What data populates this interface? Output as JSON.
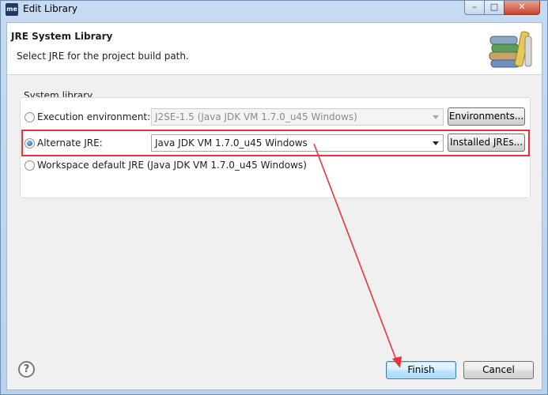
{
  "window": {
    "app_icon_text": "me",
    "title": "Edit Library",
    "minimize_glyph": "–",
    "maximize_glyph": "□",
    "close_glyph": "✕"
  },
  "header": {
    "title": "JRE System Library",
    "description": "Select JRE for the project build path."
  },
  "system_library": {
    "legend": "System library",
    "execution_environment": {
      "label": "Execution environment:",
      "selected": false,
      "value": "J2SE-1.5 (Java JDK VM 1.7.0_u45 Windows)",
      "enabled": false,
      "button": "Environments..."
    },
    "alternate_jre": {
      "label": "Alternate JRE:",
      "selected": true,
      "value": "Java JDK VM 1.7.0_u45 Windows",
      "button": "Installed JREs..."
    },
    "workspace_default": {
      "label": "Workspace default JRE (Java JDK VM 1.7.0_u45 Windows)",
      "selected": false
    }
  },
  "footer": {
    "help_glyph": "?",
    "finish_label": "Finish",
    "cancel_label": "Cancel"
  },
  "colors": {
    "annotation": "#e8343b",
    "default_button_border": "#3c7fb1"
  },
  "icons": {
    "app": "eclipse-me-icon",
    "header_graphic": "library-books-icon",
    "help": "help-icon"
  }
}
